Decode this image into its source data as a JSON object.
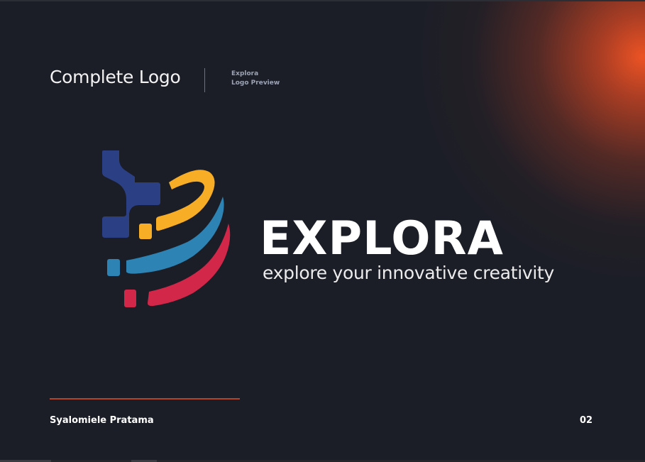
{
  "header": {
    "title": "Complete Logo",
    "meta_line1": "Explora",
    "meta_line2": "Logo Preview"
  },
  "brand": {
    "name": "EXPLORA",
    "tagline": "explore your innovative creativity",
    "colors": {
      "navy": "#2b3f85",
      "yellow": "#f7ad26",
      "blue": "#2c83b4",
      "red": "#d3274a",
      "accent_orange": "#f05424",
      "background": "#1b1e27"
    }
  },
  "footer": {
    "author": "Syalomiele Pratama",
    "page": "02"
  }
}
